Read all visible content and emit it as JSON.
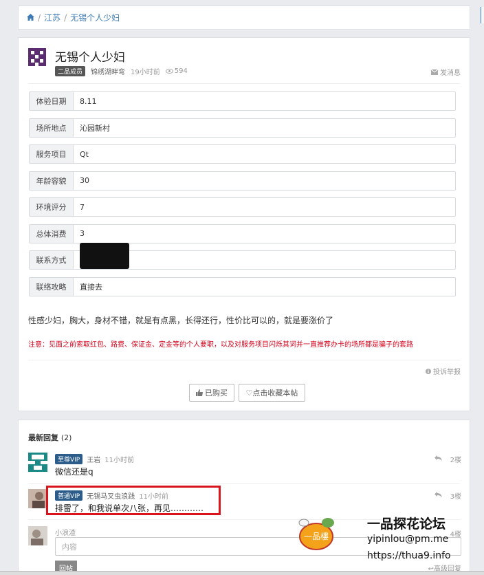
{
  "breadcrumb": {
    "home_icon": "home-icon",
    "sep": "/",
    "level1": "江苏",
    "level2": "无锡个人少妇"
  },
  "post": {
    "title": "无锡个人少妇",
    "badge": "二品成员",
    "author": "锦绣湖畔弯",
    "time": "19小时前",
    "views": "594",
    "message_label": "发消息",
    "fields": [
      {
        "label": "体验日期",
        "value": "8.11"
      },
      {
        "label": "场所地点",
        "value": "沁园新村"
      },
      {
        "label": "服务项目",
        "value": "Qt"
      },
      {
        "label": "年龄容貌",
        "value": "30"
      },
      {
        "label": "环境评分",
        "value": "7"
      },
      {
        "label": "总体消费",
        "value": "3"
      },
      {
        "label": "联系方式",
        "value": ""
      },
      {
        "label": "联络攻略",
        "value": "直接去"
      }
    ],
    "description": "性感少妇，胸大，身材不错，就是有点黑，长得还行，性价比可以的，就是要涨价了",
    "notice": "注意：见面之前索取红包、路费、保证金、定金等的个人要职，以及对服务项目闪烁其词并一直推荐办卡的场所都是骗子的套路",
    "report_label": "投诉举报",
    "bought_label": "已购买",
    "favorite_label": "♡点击收藏本帖"
  },
  "replies": {
    "title": "最新回复",
    "count": "(2)",
    "items": [
      {
        "badge": "至尊VIP",
        "user": "王岩",
        "time": "11小时前",
        "text": "微信还是q",
        "floor": "2楼"
      },
      {
        "badge": "普通VIP",
        "user": "无锡马叉虫浪践",
        "time": "11小时前",
        "text": "排雷了，和我说单次八张，再见…………",
        "floor": "3楼"
      }
    ],
    "compose": {
      "user": "小浪渣",
      "placeholder": "内容",
      "submit": "回帖",
      "advanced": "高级回复",
      "floor": "4楼"
    }
  },
  "watermark": {
    "logo_text": "一品樓",
    "title": "一品探花论坛",
    "email": "yipinlou@pm.me",
    "url": "https://thua9.info"
  },
  "colors": {
    "accent": "#3c7bb6",
    "notice": "#d0021b",
    "highlight": "#d9141c"
  }
}
